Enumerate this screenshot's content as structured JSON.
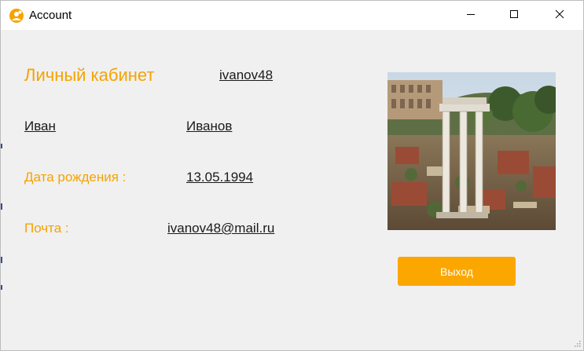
{
  "window": {
    "title": "Account",
    "minimize_icon": "minimize-icon",
    "maximize_icon": "maximize-icon",
    "close_icon": "close-icon",
    "app_icon": "user-app-icon"
  },
  "profile": {
    "heading": "Личный кабинет",
    "login": "ivanov48",
    "first_name": "Иван",
    "last_name": "Иванов",
    "dob_label": "Дата рождения :",
    "dob_value": "13.05.1994",
    "mail_label": "Почта :",
    "mail_value": "ivanov48@mail.ru"
  },
  "photo": {
    "icon": "profile-photo"
  },
  "actions": {
    "exit_label": "Выход"
  },
  "colors": {
    "accent": "#f5a300",
    "button": "#fba700",
    "background": "#f0f0f0",
    "titlebar": "#ffffff"
  }
}
